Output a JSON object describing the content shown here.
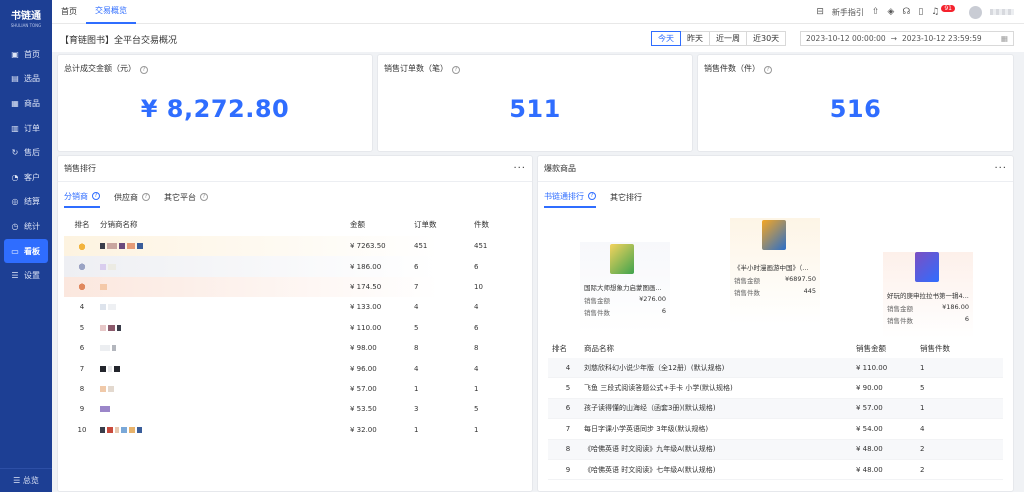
{
  "brand": {
    "name": "书链通",
    "sub": "SHULIAN TONG"
  },
  "sidebar": {
    "items": [
      {
        "icon": "▣",
        "label": "首页"
      },
      {
        "icon": "▤",
        "label": "选品"
      },
      {
        "icon": "▦",
        "label": "商品"
      },
      {
        "icon": "▥",
        "label": "订单"
      },
      {
        "icon": "↻",
        "label": "售后"
      },
      {
        "icon": "◔",
        "label": "客户"
      },
      {
        "icon": "◎",
        "label": "结算"
      },
      {
        "icon": "◷",
        "label": "统计"
      },
      {
        "icon": "▭",
        "label": "看板"
      },
      {
        "icon": "☰",
        "label": "设置"
      }
    ],
    "bottom": "☰ 总览"
  },
  "topbar": {
    "tabs": [
      "首页",
      "交易概览"
    ],
    "guide": "新手指引",
    "badge": "91"
  },
  "filter": {
    "title": "【育链图书】全平台交易概况",
    "segments": [
      "今天",
      "昨天",
      "近一周",
      "近30天"
    ],
    "start": "2023-10-12 00:00:00",
    "arrow": "→",
    "end": "2023-10-12 23:59:59"
  },
  "stats": {
    "total_label": "总计成交金额（元）",
    "total_value": "¥ 8,272.80",
    "orders_label": "销售订单数（笔）",
    "orders_value": "511",
    "items_label": "销售件数（件）",
    "items_value": "516"
  },
  "ranking": {
    "title": "销售排行",
    "more": "···",
    "tabs": [
      "分销商",
      "供应商",
      "其它平台"
    ],
    "headers": [
      "排名",
      "分销商名称",
      "金额",
      "订单数",
      "件数"
    ],
    "rows": [
      {
        "rank": "",
        "amount": "¥ 7263.50",
        "orders": "451",
        "qty": "451"
      },
      {
        "rank": "",
        "amount": "¥ 186.00",
        "orders": "6",
        "qty": "6"
      },
      {
        "rank": "",
        "amount": "¥ 174.50",
        "orders": "7",
        "qty": "10"
      },
      {
        "rank": "4",
        "amount": "¥ 133.00",
        "orders": "4",
        "qty": "4"
      },
      {
        "rank": "5",
        "amount": "¥ 110.00",
        "orders": "5",
        "qty": "6"
      },
      {
        "rank": "6",
        "amount": "¥ 98.00",
        "orders": "8",
        "qty": "8"
      },
      {
        "rank": "7",
        "amount": "¥ 96.00",
        "orders": "4",
        "qty": "4"
      },
      {
        "rank": "8",
        "amount": "¥ 57.00",
        "orders": "1",
        "qty": "1"
      },
      {
        "rank": "9",
        "amount": "¥ 53.50",
        "orders": "3",
        "qty": "5"
      },
      {
        "rank": "10",
        "amount": "¥ 32.00",
        "orders": "1",
        "qty": "1"
      }
    ]
  },
  "hot": {
    "title": "爆款商品",
    "more": "···",
    "tabs": [
      "书链通排行",
      "其它排行"
    ],
    "podium": [
      {
        "name": "国际大师想象力启蒙图画...",
        "amount_label": "销售金额",
        "amount": "¥276.00",
        "qty_label": "销售件数",
        "qty": "6"
      },
      {
        "name": "《半小时漫画游中国》（...",
        "amount_label": "销售金额",
        "amount": "¥6897.50",
        "qty_label": "销售件数",
        "qty": "445"
      },
      {
        "name": "好玩的庚申拉拉书第一辑4...",
        "amount_label": "销售金额",
        "amount": "¥186.00",
        "qty_label": "销售件数",
        "qty": "6"
      }
    ],
    "headers": [
      "排名",
      "商品名称",
      "销售金额",
      "销售件数"
    ],
    "rows": [
      {
        "rank": "4",
        "name": "刘慈欣科幻小说少年版（全12册）(默认规格)",
        "amount": "¥ 110.00",
        "qty": "1"
      },
      {
        "rank": "5",
        "name": "飞鱼 三段式阅读答题公式+手卡 小学(默认规格)",
        "amount": "¥ 90.00",
        "qty": "5"
      },
      {
        "rank": "6",
        "name": "孩子读得懂的山海经（函套3册)(默认规格)",
        "amount": "¥ 57.00",
        "qty": "1"
      },
      {
        "rank": "7",
        "name": "每日字课小学英语同步 3年级(默认规格)",
        "amount": "¥ 54.00",
        "qty": "4"
      },
      {
        "rank": "8",
        "name": "《哈佛英语 时文阅读》九年级A(默认规格)",
        "amount": "¥ 48.00",
        "qty": "2"
      },
      {
        "rank": "9",
        "name": "《哈佛英语 时文阅读》七年级A(默认规格)",
        "amount": "¥ 48.00",
        "qty": "2"
      }
    ]
  },
  "colors": {
    "accent": "#2f6dff",
    "sidebar": "#1d3f94"
  }
}
